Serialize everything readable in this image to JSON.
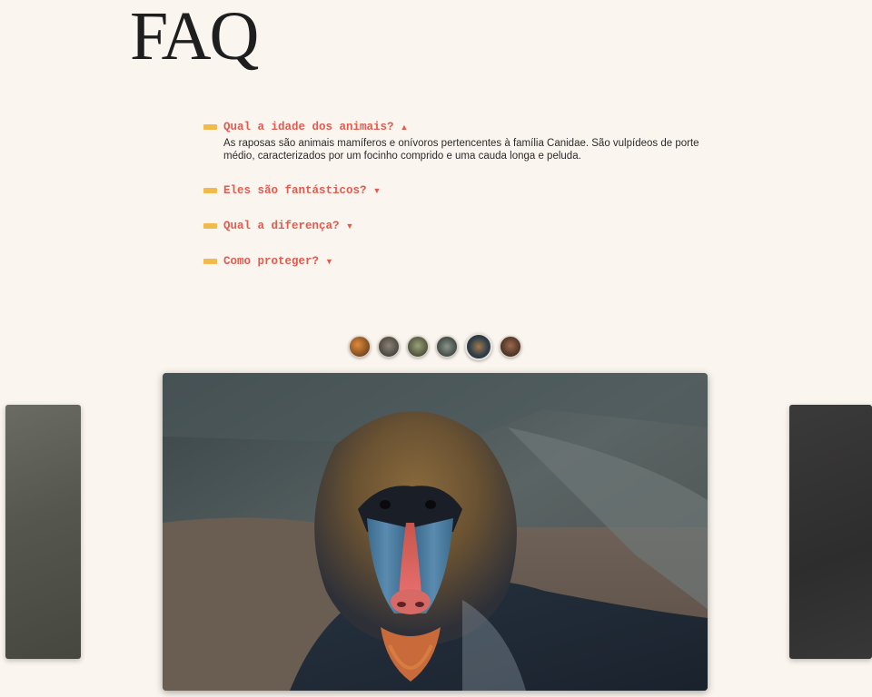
{
  "page": {
    "title": "FAQ"
  },
  "faq": {
    "items": [
      {
        "question": "Qual a idade dos animais?",
        "expanded": true,
        "answer": "As raposas são animais mamíferos e onívoros pertencentes à família Canidae. São vulpídeos de porte médio, caracterizados por um focinho comprido e uma cauda longa e peluda."
      },
      {
        "question": "Eles são fantásticos?",
        "expanded": false
      },
      {
        "question": "Qual a diferença?",
        "expanded": false
      },
      {
        "question": "Como proteger?",
        "expanded": false
      }
    ],
    "icons": {
      "expanded": "▲",
      "collapsed": "▼"
    }
  },
  "gallery": {
    "thumbnails": [
      "fox",
      "monkey",
      "bear",
      "wolf",
      "mandrill",
      "monkey"
    ],
    "active_index": 4,
    "main_image": "mandrill"
  },
  "colors": {
    "background": "#faf5ee",
    "accent_text": "#e35a4e",
    "accent_bar": "#f2b94c",
    "title": "#1e1e1e"
  }
}
